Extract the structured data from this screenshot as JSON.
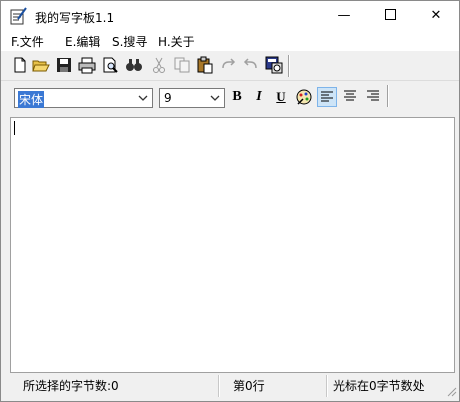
{
  "window": {
    "title": "我的写字板1.1",
    "minimize_glyph": "—",
    "close_glyph": "✕"
  },
  "menu": {
    "items": [
      "F.文件",
      "E.编辑",
      "S.搜寻",
      "H.关于"
    ]
  },
  "toolbar": {
    "icons": [
      "new-file-icon",
      "open-folder-icon",
      "save-icon",
      "print-icon",
      "print-preview-icon",
      "find-icon",
      "cut-icon",
      "copy-icon",
      "paste-icon",
      "redo-icon",
      "undo-icon",
      "datetime-icon"
    ]
  },
  "format": {
    "font_name": "宋体",
    "font_size": "9",
    "bold_label": "B",
    "italic_label": "I",
    "underline_label": "U",
    "align_active": "left"
  },
  "editor": {
    "text": ""
  },
  "status": {
    "selected_count": "所选择的字节数:0",
    "line": "第0行",
    "caret_pos": "光标在0字节数处"
  },
  "colors": {
    "selection": "#3a78d4",
    "active_button": "#cde4f7",
    "toolbar_bg": "#f0f0f0"
  }
}
